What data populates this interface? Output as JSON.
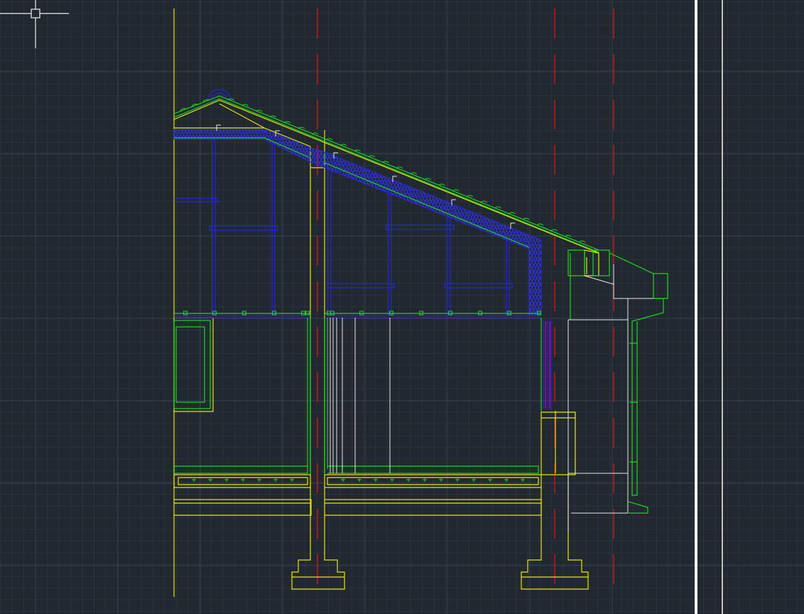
{
  "app": {
    "view": "cad-model-space",
    "drawing": "building-section"
  },
  "colors": {
    "background": "#212830",
    "grid_minor": "#2a323b",
    "grid_major": "#34404b",
    "yellow": "#e6e600",
    "green": "#1ed41e",
    "blue": "#2020d8",
    "white": "#e8e8e8",
    "red": "#c81414",
    "magenta": "#c400c4"
  },
  "crosshair": {
    "icon": "cad-crosshair-cursor-icon"
  }
}
